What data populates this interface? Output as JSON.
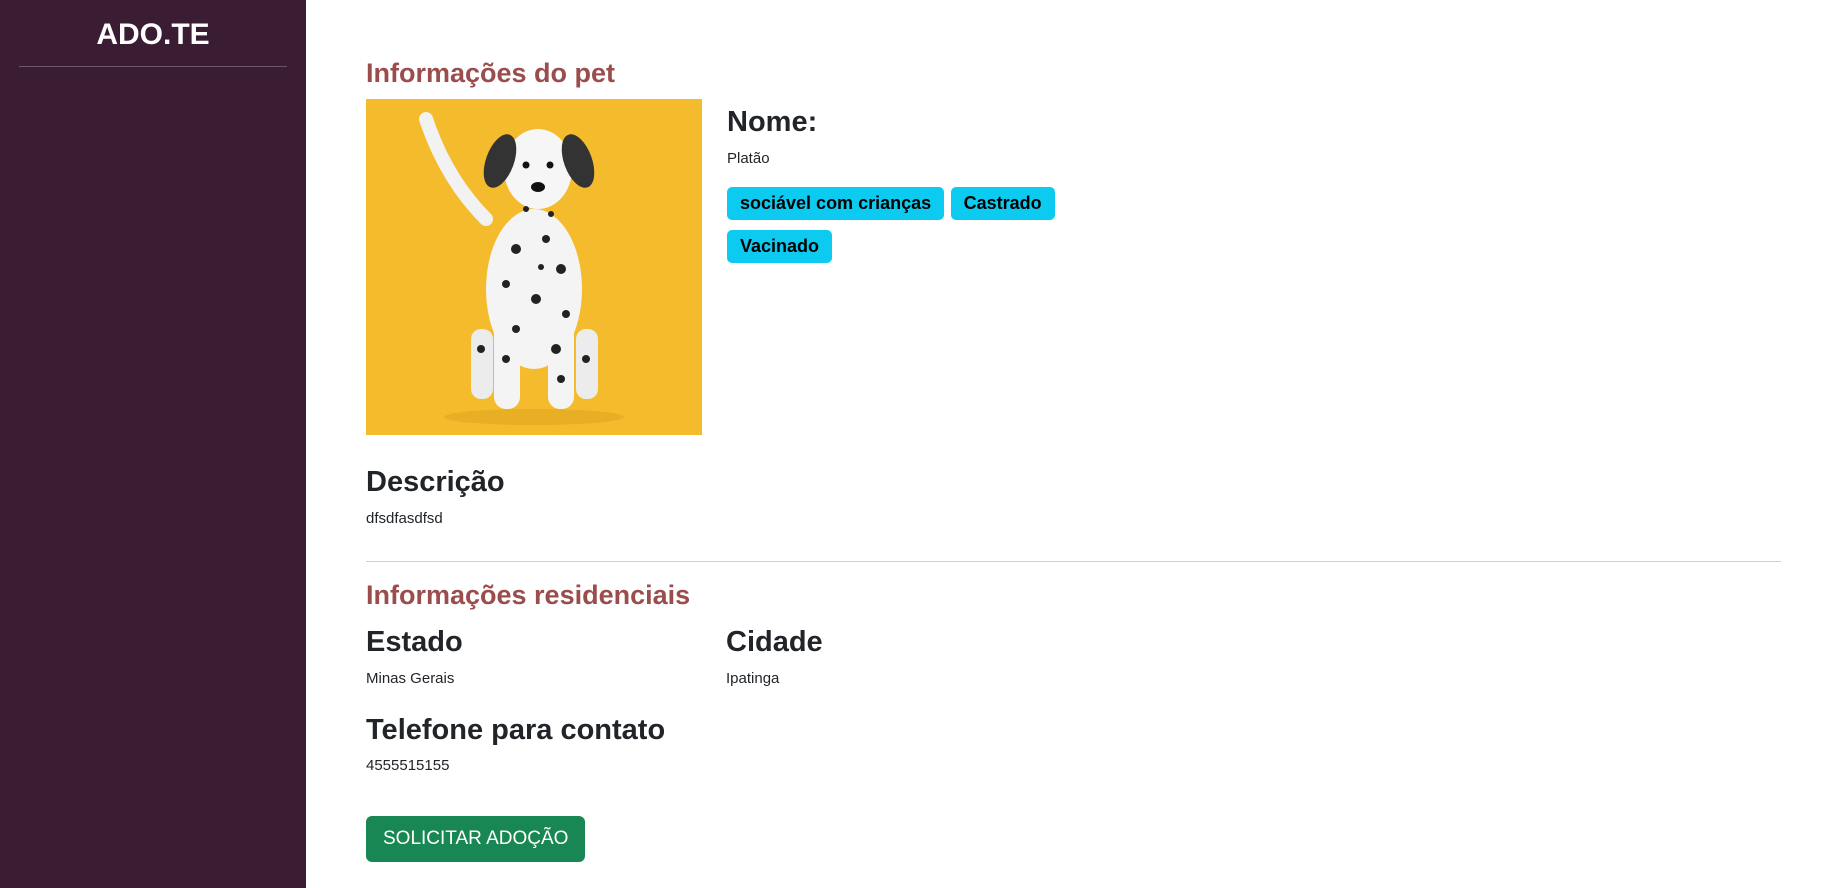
{
  "sidebar": {
    "brand": "ADO.TE"
  },
  "pet": {
    "section_title": "Informações do pet",
    "name_label": "Nome:",
    "name": "Platão",
    "tags": [
      "sociável com crianças",
      "Castrado",
      "Vacinado"
    ],
    "description_label": "Descrição",
    "description": "dfsdfasdfsd"
  },
  "residence": {
    "section_title": "Informações residenciais",
    "state_label": "Estado",
    "state": "Minas Gerais",
    "city_label": "Cidade",
    "city": "Ipatinga",
    "phone_label": "Telefone para contato",
    "phone": "4555515155"
  },
  "actions": {
    "adopt_button": "SOLICITAR ADOÇÃO"
  },
  "colors": {
    "sidebar_bg": "#3a1d33",
    "section_title": "#9b4d4d",
    "tag_bg": "#0dcaf0",
    "button_bg": "#198754",
    "photo_bg": "#f4bb2c"
  }
}
